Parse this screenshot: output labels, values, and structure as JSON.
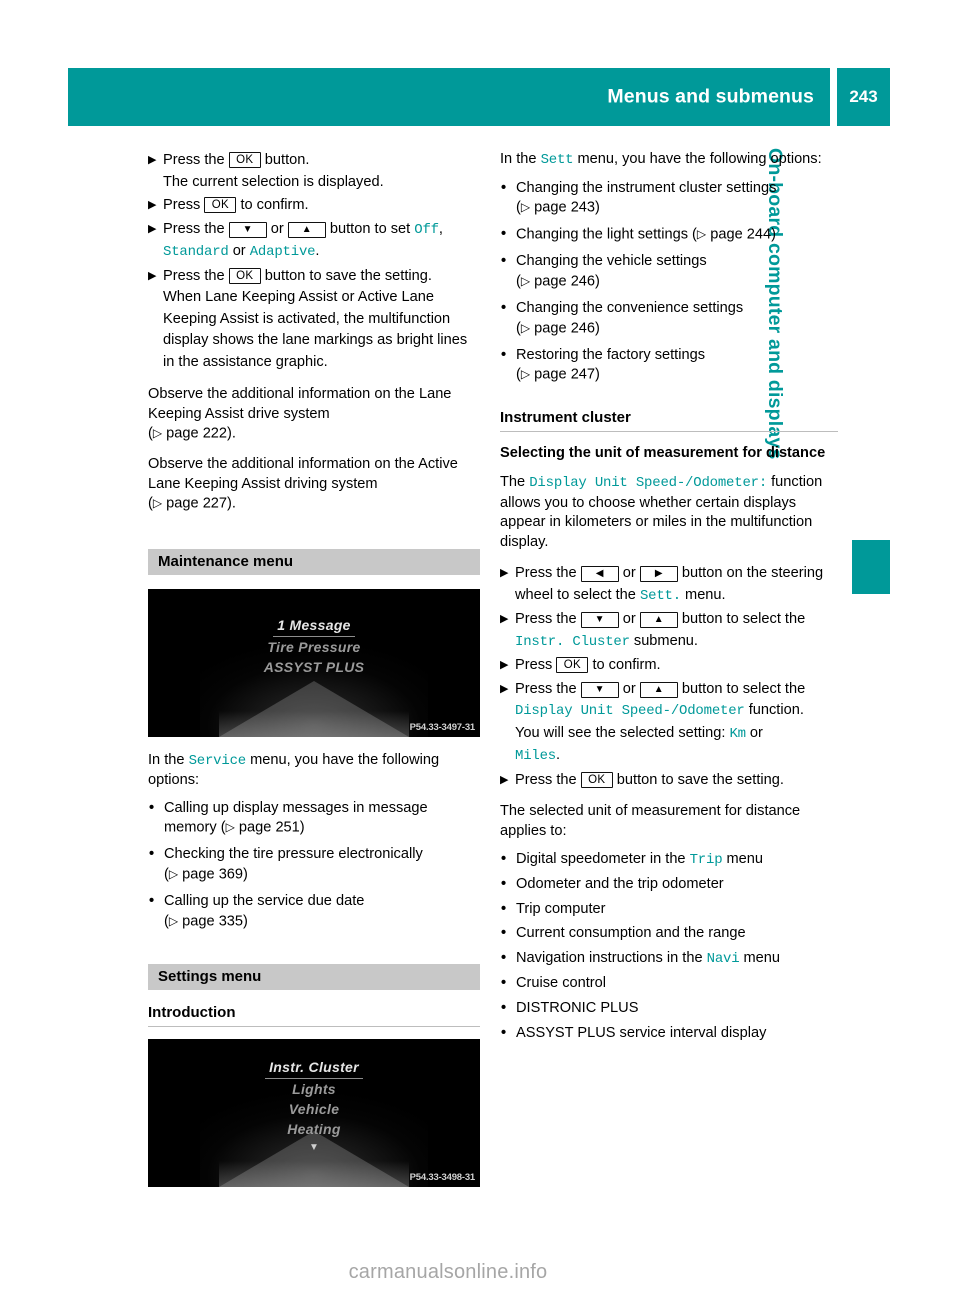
{
  "header": {
    "title": "Menus and submenus",
    "page_number": "243"
  },
  "side_tab": {
    "label": "On-board computer and displays"
  },
  "colors": {
    "accent_teal": "#009999",
    "section_bar_gray": "#c8c8c8",
    "rule_gray": "#bdbdbd"
  },
  "left_column": {
    "steps": [
      {
        "lead": "Press the",
        "key": "OK",
        "trail": "button.",
        "continuation": "The current selection is displayed."
      },
      {
        "lead": "Press",
        "key": "OK",
        "trail": "to confirm.",
        "continuation": ""
      }
    ],
    "step_set": {
      "lead": "Press the",
      "key_down": "▼",
      "or": "or",
      "key_up": "▲",
      "trail": "button to set",
      "value_1": "Off",
      "comma": ",",
      "value_2": "Standard",
      "or_2": "or",
      "value_3": "Adaptive",
      "period": "."
    },
    "step_save": {
      "lead": "Press the",
      "key": "OK",
      "trail": "button to save the setting.",
      "continuation": "When Lane Keeping Assist or Active Lane Keeping Assist is activated, the multifunction display shows the lane markings as bright lines in the assistance graphic."
    },
    "note_1": "Observe the additional information on the Lane Keeping Assist drive system",
    "note_1_ref": "page 222",
    "note_2": "Observe the additional information on the Active Lane Keeping Assist driving system",
    "note_2_ref": "page 227",
    "maintenance_section": "Maintenance menu",
    "cluster_image_1": {
      "lines": [
        "1 Message",
        "Tire Pressure",
        "ASSYST PLUS"
      ],
      "selected_index": 0,
      "code": "P54.33-3497-31"
    },
    "service_intro_pre": "In the",
    "service_intro_menu": "Service",
    "service_intro_post": "menu, you have the following options:",
    "service_bullets": [
      {
        "text": "Calling up display messages in message memory",
        "ref": "page 251",
        "inline_ref": true
      },
      {
        "text": "Checking the tire pressure electronically",
        "ref": "page 369",
        "inline_ref": false
      },
      {
        "text": "Calling up the service due date",
        "ref": "page 335",
        "inline_ref": false
      }
    ],
    "settings_section": "Settings menu",
    "introduction_heading": "Introduction",
    "cluster_image_2": {
      "lines": [
        "Instr. Cluster",
        "Lights",
        "Vehicle",
        "Heating"
      ],
      "selected_index": 0,
      "has_down_caret": true,
      "code": "P54.33-3498-31"
    }
  },
  "right_column": {
    "sett_intro_pre": "In the",
    "sett_intro_menu": "Sett",
    "sett_intro_post": "menu, you have the following options:",
    "sett_bullets": [
      {
        "text": "Changing the instrument cluster settings",
        "ref": "page 243",
        "inline_ref": false
      },
      {
        "text": "Changing the light settings",
        "ref": "page 244",
        "inline_ref": true
      },
      {
        "text": "Changing the vehicle settings",
        "ref": "page 246",
        "inline_ref": false
      },
      {
        "text": "Changing the convenience settings",
        "ref": "page 246",
        "inline_ref": false
      },
      {
        "text": "Restoring the factory settings",
        "ref": "page 247",
        "inline_ref": false
      }
    ],
    "instrument_cluster_heading": "Instrument cluster",
    "unit_subhead": "Selecting the unit of measurement for distance",
    "unit_para_pre": "The",
    "unit_para_func": "Display Unit Speed-/Odometer:",
    "unit_para_post": "function allows you to choose whether certain displays appear in kilometers or miles in the multifunction display.",
    "step_steering": {
      "lead": "Press the",
      "key_left": "◀",
      "or": "or",
      "key_right": "▶",
      "trail": "button on the steering wheel to select the",
      "menu": "Sett.",
      "trail2": "menu."
    },
    "step_submenu": {
      "lead": "Press the",
      "key_down": "▼",
      "or": "or",
      "key_up": "▲",
      "trail": "button to select the",
      "menu": "Instr. Cluster",
      "trail2": "submenu."
    },
    "step_confirm": {
      "lead": "Press",
      "key": "OK",
      "trail": "to confirm."
    },
    "step_function": {
      "lead": "Press the",
      "key_down": "▼",
      "or": "or",
      "key_up": "▲",
      "trail": "button to select the",
      "menu": "Display Unit Speed-/Odometer",
      "trail2": "function.",
      "continuation_pre": "You will see the selected setting:",
      "value_1": "Km",
      "value_2": "Miles",
      "period": "."
    },
    "step_save": {
      "lead": "Press the",
      "key": "OK",
      "trail": "button to save the setting."
    },
    "applies_intro": "The selected unit of measurement for distance applies to:",
    "applies_bullets": [
      {
        "pre": "Digital speedometer in the",
        "menu": "Trip",
        "post": "menu"
      },
      {
        "pre": "Odometer and the trip odometer",
        "menu": "",
        "post": ""
      },
      {
        "pre": "Trip computer",
        "menu": "",
        "post": ""
      },
      {
        "pre": "Current consumption and the range",
        "menu": "",
        "post": ""
      },
      {
        "pre": "Navigation instructions in the",
        "menu": "Navi",
        "post": "menu"
      },
      {
        "pre": "Cruise control",
        "menu": "",
        "post": ""
      },
      {
        "pre": "DISTRONIC PLUS",
        "menu": "",
        "post": ""
      },
      {
        "pre": "ASSYST PLUS service interval display",
        "menu": "",
        "post": ""
      }
    ]
  },
  "footer": {
    "watermark": "carmanualsonline.info"
  }
}
